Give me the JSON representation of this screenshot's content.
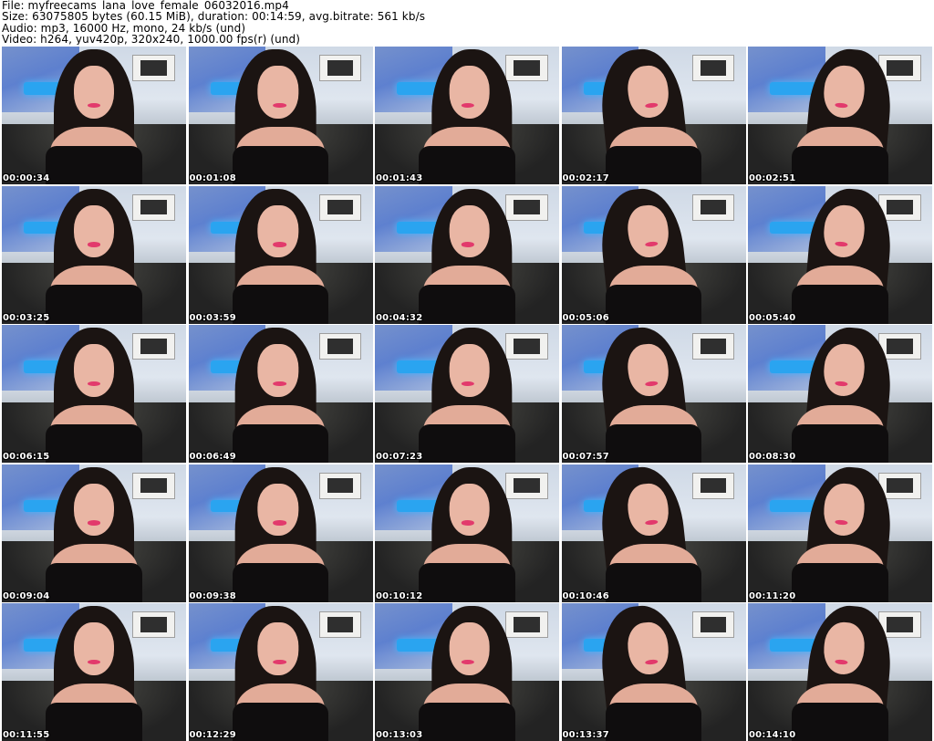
{
  "header": {
    "file_line": "File: myfreecams_lana_love_female_06032016.mp4",
    "size_line": "Size: 63075805 bytes (60.15 MiB), duration: 00:14:59, avg.bitrate: 561 kb/s",
    "audio_line": "Audio: mp3, 16000 Hz, mono, 24 kb/s (und)",
    "video_line": "Video: h264, yuv420p, 320x240, 1000.00 fps(r) (und)"
  },
  "thumbnails": [
    {
      "timestamp": "00:00:34"
    },
    {
      "timestamp": "00:01:08"
    },
    {
      "timestamp": "00:01:43"
    },
    {
      "timestamp": "00:02:17"
    },
    {
      "timestamp": "00:02:51"
    },
    {
      "timestamp": "00:03:25"
    },
    {
      "timestamp": "00:03:59"
    },
    {
      "timestamp": "00:04:32"
    },
    {
      "timestamp": "00:05:06"
    },
    {
      "timestamp": "00:05:40"
    },
    {
      "timestamp": "00:06:15"
    },
    {
      "timestamp": "00:06:49"
    },
    {
      "timestamp": "00:07:23"
    },
    {
      "timestamp": "00:07:57"
    },
    {
      "timestamp": "00:08:30"
    },
    {
      "timestamp": "00:09:04"
    },
    {
      "timestamp": "00:09:38"
    },
    {
      "timestamp": "00:10:12"
    },
    {
      "timestamp": "00:10:46"
    },
    {
      "timestamp": "00:11:20"
    },
    {
      "timestamp": "00:11:55"
    },
    {
      "timestamp": "00:12:29"
    },
    {
      "timestamp": "00:13:03"
    },
    {
      "timestamp": "00:13:37"
    },
    {
      "timestamp": "00:14:10"
    }
  ]
}
